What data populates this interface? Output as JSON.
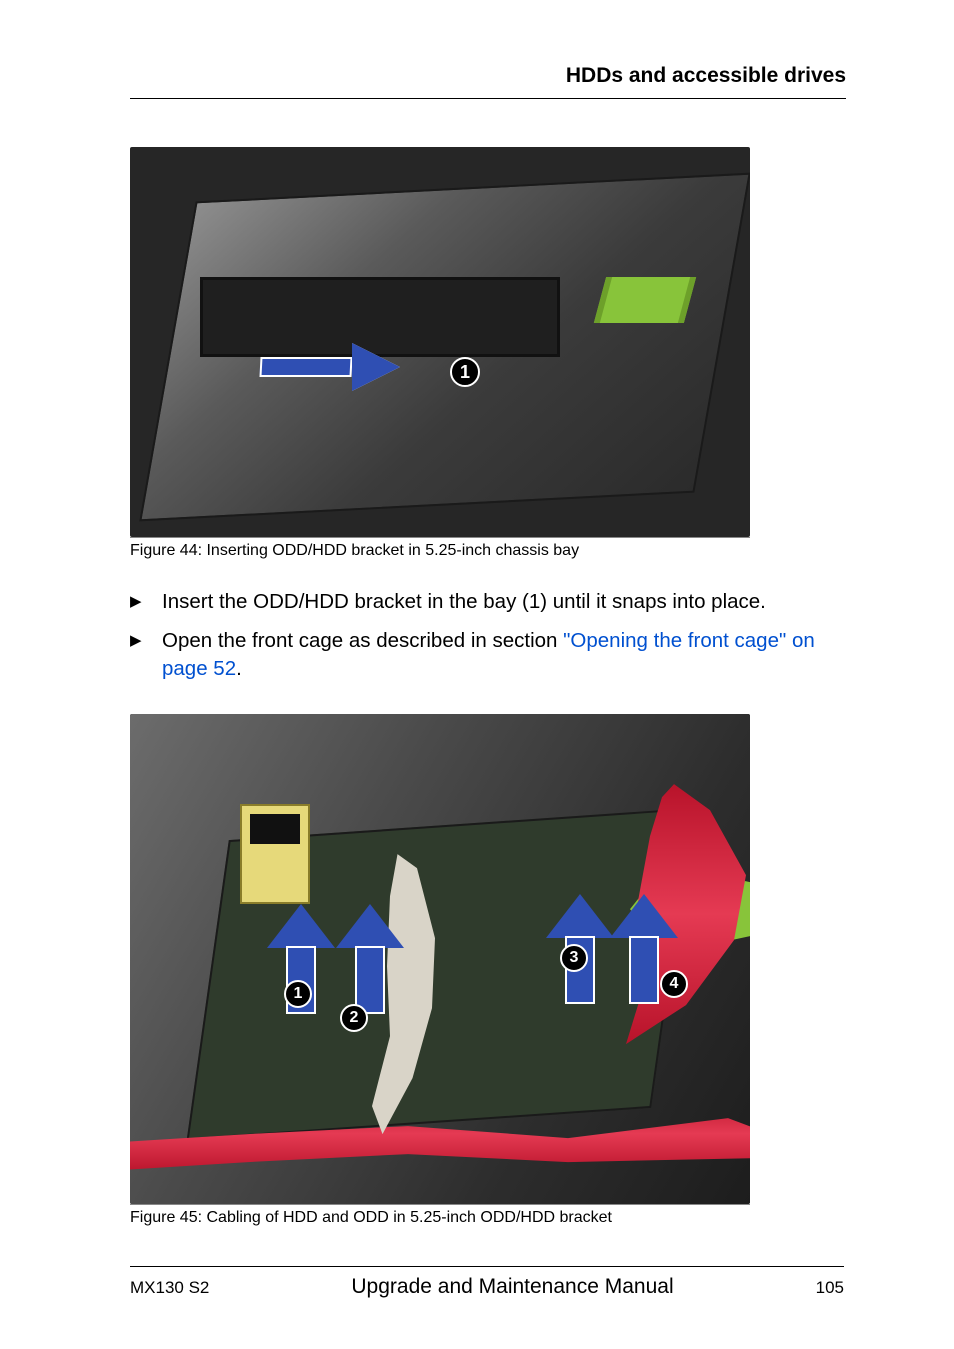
{
  "header": {
    "section_title": "HDDs and accessible drives"
  },
  "figure1": {
    "caption": "Figure 44: Inserting ODD/HDD bracket in 5.25-inch chassis bay",
    "marker1": "1"
  },
  "bullets": [
    {
      "text_plain": "Insert the ODD/HDD bracket in the bay (1) until it snaps into place."
    },
    {
      "text_prefix": "Open the front cage as described in section ",
      "text_link": "\"Opening the front cage\" on page 52",
      "text_suffix": "."
    }
  ],
  "figure2": {
    "caption": "Figure 45: Cabling of HDD and ODD in 5.25-inch ODD/HDD bracket",
    "markers": {
      "m1": "1",
      "m2": "2",
      "m3": "3",
      "m4": "4"
    }
  },
  "footer": {
    "left": "MX130 S2",
    "center": "Upgrade and Maintenance Manual",
    "right": "105"
  }
}
